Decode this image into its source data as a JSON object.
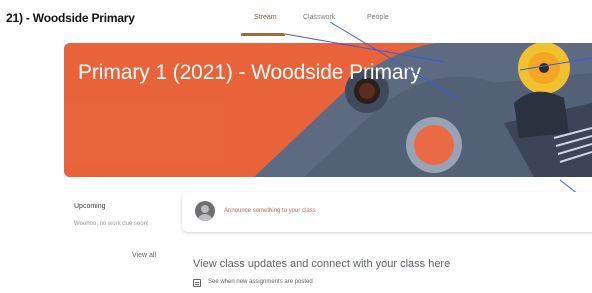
{
  "header": {
    "class_name": "21) - Woodside Primary",
    "tabs": [
      {
        "label": "Stream",
        "active": true
      },
      {
        "label": "Classwork",
        "active": false
      },
      {
        "label": "People",
        "active": false
      }
    ]
  },
  "banner": {
    "title": "Primary 1 (2021) - Woodside Primary",
    "color": "#e8633a"
  },
  "upcoming": {
    "title": "Upcoming",
    "note": "Woohoo, no work due soon!",
    "view_all": "View all"
  },
  "announce": {
    "prompt": "Announce something to your class"
  },
  "stream": {
    "empty_heading": "View class updates and connect with your class here",
    "hint": "See when new assignments are posted"
  }
}
